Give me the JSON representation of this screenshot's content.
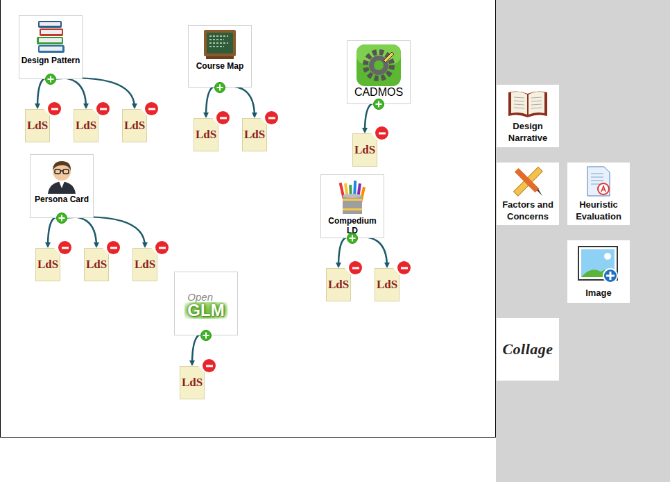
{
  "canvas": {
    "nodes": [
      {
        "kind": "books",
        "label": "Design Pattern",
        "children": [
          {
            "label": "LdS"
          },
          {
            "label": "LdS"
          },
          {
            "label": "LdS"
          }
        ]
      },
      {
        "kind": "board",
        "label": "Course Map",
        "children": [
          {
            "label": "LdS"
          },
          {
            "label": "LdS"
          }
        ]
      },
      {
        "kind": "cadmos",
        "label": "CADMOS",
        "children": [
          {
            "label": "LdS"
          }
        ]
      },
      {
        "kind": "persona",
        "label": "Persona Card",
        "children": [
          {
            "label": "LdS"
          },
          {
            "label": "LdS"
          },
          {
            "label": "LdS"
          }
        ]
      },
      {
        "kind": "pencils",
        "label": "Compedium LD",
        "children": [
          {
            "label": "LdS"
          },
          {
            "label": "LdS"
          }
        ]
      },
      {
        "kind": "openglm",
        "label": "GLM",
        "sublabel": "Open",
        "children": [
          {
            "label": "LdS"
          }
        ]
      }
    ]
  },
  "palette": [
    {
      "kind": "book",
      "label": "Design Narrative"
    },
    {
      "kind": "tools",
      "label": "Factors and Concerns"
    },
    {
      "kind": "doc",
      "label": "Heuristic Evaluation"
    },
    {
      "kind": "image",
      "label": "Image"
    },
    {
      "kind": "collage",
      "label": "Collage"
    }
  ]
}
